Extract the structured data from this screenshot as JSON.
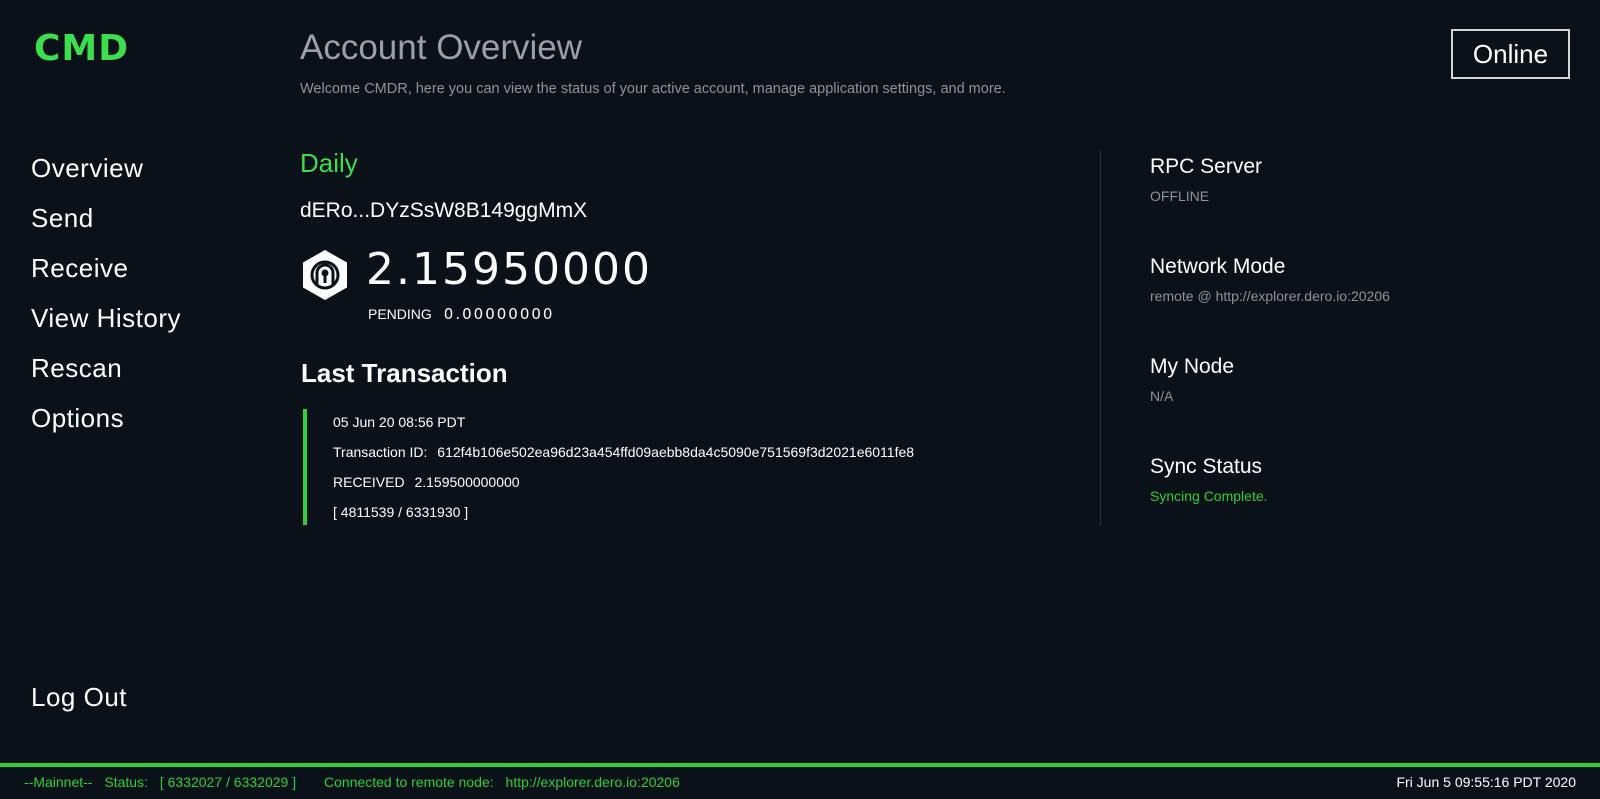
{
  "app": {
    "logo": "CMD"
  },
  "header": {
    "title": "Account Overview",
    "subtitle": "Welcome CMDR, here you can view the status of your active account, manage application settings, and more.",
    "status_button": "Online"
  },
  "sidebar": {
    "items": [
      {
        "label": "Overview"
      },
      {
        "label": "Send"
      },
      {
        "label": "Receive"
      },
      {
        "label": "View History"
      },
      {
        "label": "Rescan"
      },
      {
        "label": "Options"
      }
    ],
    "logout_label": "Log Out"
  },
  "account": {
    "name": "Daily",
    "address": "dERo...DYzSsW8B149ggMmX",
    "balance": "2.15950000",
    "pending_label": "PENDING",
    "pending_value": "0.00000000"
  },
  "last_transaction": {
    "title": "Last Transaction",
    "date": "05 Jun 20 08:56 PDT",
    "txid_label": "Transaction ID:",
    "txid": "612f4b106e502ea96d23a454ffd09aebb8da4c5090e751569f3d2021e6011fe8",
    "direction": "RECEIVED",
    "amount": "2.159500000000",
    "height_range": "[ 4811539 / 6331930 ]"
  },
  "info": {
    "rpc_label": "RPC Server",
    "rpc_value": "OFFLINE",
    "network_label": "Network Mode",
    "network_value": "remote @ http://explorer.dero.io:20206",
    "node_label": "My Node",
    "node_value": "N/A",
    "sync_label": "Sync Status",
    "sync_value": "Syncing Complete."
  },
  "footer": {
    "network": "--Mainnet--",
    "status_label": "Status:",
    "status_value": "[ 6332027 / 6332029 ]",
    "connected_label": "Connected to remote node:",
    "connected_value": "http://explorer.dero.io:20206",
    "datetime": "Fri Jun  5 09:55:16 PDT 2020"
  },
  "colors": {
    "accent": "#3cde4e",
    "background": "#0a1118",
    "muted": "#8d9399"
  }
}
